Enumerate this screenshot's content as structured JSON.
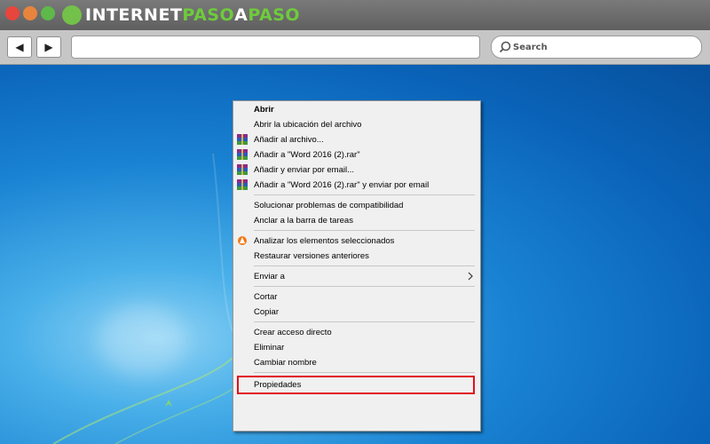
{
  "browser": {
    "brand": {
      "part1": "INTERNET",
      "part2": "PASO",
      "part3": "A",
      "part4": "PASO"
    },
    "search": {
      "placeholder": "Search"
    },
    "nav": {
      "back_icon": "◀",
      "forward_icon": "▶"
    }
  },
  "context_menu": {
    "items": [
      {
        "label": "Abrir",
        "bold": true,
        "icon": null
      },
      {
        "label": "Abrir la ubicación del archivo",
        "icon": null
      },
      {
        "label": "Añadir al archivo...",
        "icon": "winrar-icon"
      },
      {
        "label": "Añadir a \"Word 2016 (2).rar\"",
        "icon": "winrar-icon"
      },
      {
        "label": "Añadir y enviar por email...",
        "icon": "winrar-icon"
      },
      {
        "label": "Añadir a \"Word 2016 (2).rar\" y enviar por email",
        "icon": "winrar-icon"
      },
      {
        "label": "Solucionar problemas de compatibilidad",
        "icon": null
      },
      {
        "label": "Anclar a la barra de tareas",
        "icon": null
      },
      {
        "label": "Analizar los elementos seleccionados",
        "icon": "avast-icon"
      },
      {
        "label": "Restaurar versiones anteriores",
        "icon": null
      },
      {
        "label": "Enviar a",
        "icon": null,
        "submenu": true
      },
      {
        "label": "Cortar",
        "icon": null
      },
      {
        "label": "Copiar",
        "icon": null
      },
      {
        "label": "Crear acceso directo",
        "icon": null
      },
      {
        "label": "Eliminar",
        "icon": null
      },
      {
        "label": "Cambiar nombre",
        "icon": null
      },
      {
        "label": "Propiedades",
        "icon": null,
        "highlighted": true
      }
    ]
  },
  "colors": {
    "highlight": "#e0101c",
    "brand_green": "#6ecb3c"
  }
}
